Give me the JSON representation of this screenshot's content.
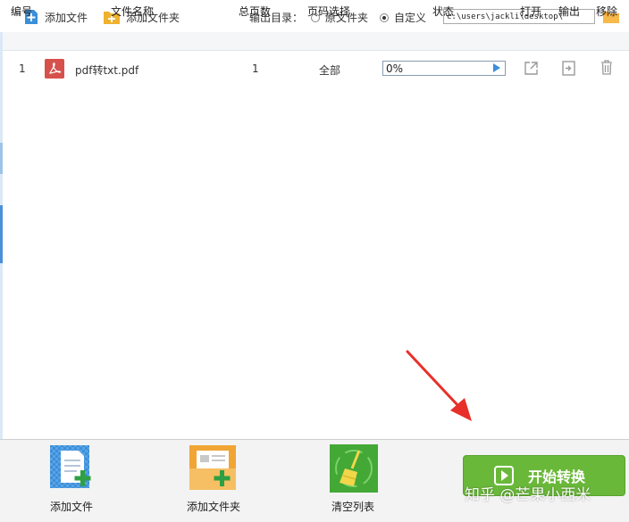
{
  "toolbar": {
    "add_file_label": "添加文件",
    "add_folder_label": "添加文件夹",
    "output_dir_label": "输出目录：",
    "radio_original_label": "原文件夹",
    "radio_custom_label": "自定义",
    "selected_radio": "自定义",
    "output_path": "c:\\users\\jackli\\desktop\\"
  },
  "table": {
    "headers": {
      "index": "编号",
      "filename": "文件名称",
      "pages": "总页数",
      "page_select": "页码选择",
      "status": "状态",
      "open": "打开",
      "output": "输出",
      "remove": "移除"
    },
    "rows": [
      {
        "index": "1",
        "filename": "pdf转txt.pdf",
        "pages": "1",
        "page_select": "全部",
        "progress_text": "0%",
        "progress": 0
      }
    ]
  },
  "bottom": {
    "add_file_label": "添加文件",
    "add_folder_label": "添加文件夹",
    "clear_list_label": "清空列表",
    "start_label": "开始转换"
  },
  "watermark": "知乎 @芒果小西米",
  "colors": {
    "accent_blue": "#3b8fd9",
    "start_green": "#6ab83a",
    "pdf_red": "#d6504c",
    "folder_orange": "#f0a535",
    "arrow_red": "#e8302a"
  }
}
